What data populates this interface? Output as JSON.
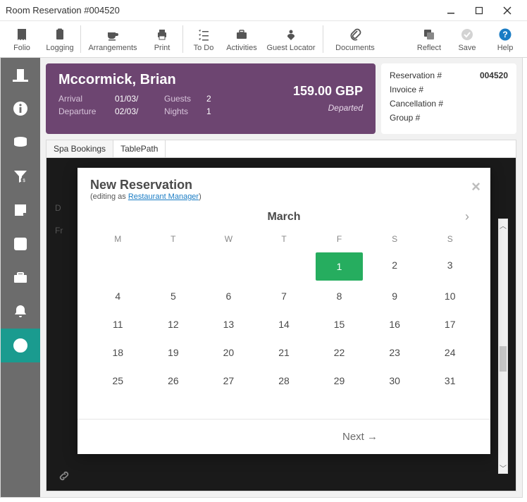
{
  "window": {
    "title": "Room Reservation #004520"
  },
  "toolbar": {
    "folio": "Folio",
    "logging": "Logging",
    "arrangements": "Arrangements",
    "print": "Print",
    "todo": "To Do",
    "activities": "Activities",
    "guest_locator": "Guest Locator",
    "documents": "Documents",
    "reflect": "Reflect",
    "save": "Save",
    "help": "Help"
  },
  "guest": {
    "name": "Mccormick, Brian",
    "arrival_label": "Arrival",
    "arrival": "01/03/",
    "departure_label": "Departure",
    "departure": "02/03/",
    "guests_label": "Guests",
    "guests": "2",
    "nights_label": "Nights",
    "nights": "1",
    "amount": "159.00 GBP",
    "status": "Departed"
  },
  "ref": {
    "reservation_label": "Reservation #",
    "reservation": "004520",
    "invoice_label": "Invoice #",
    "invoice": "",
    "cancellation_label": "Cancellation #",
    "cancellation": "",
    "group_label": "Group #",
    "group": ""
  },
  "tabs": {
    "spa": "Spa Bookings",
    "tablepath": "TablePath"
  },
  "bg": {
    "label1": "D",
    "label2": "Fr"
  },
  "modal": {
    "title": "New Reservation",
    "editing_prefix": "(editing as  ",
    "role": "Restaurant Manager",
    "editing_suffix": ")",
    "month": "March",
    "dows": [
      "M",
      "T",
      "W",
      "T",
      "F",
      "S",
      "S"
    ],
    "weeks": [
      [
        "",
        "",
        "",
        "",
        "1",
        "2",
        "3"
      ],
      [
        "4",
        "5",
        "6",
        "7",
        "8",
        "9",
        "10"
      ],
      [
        "11",
        "12",
        "13",
        "14",
        "15",
        "16",
        "17"
      ],
      [
        "18",
        "19",
        "20",
        "21",
        "22",
        "23",
        "24"
      ],
      [
        "25",
        "26",
        "27",
        "28",
        "29",
        "30",
        "31"
      ]
    ],
    "selected": "1",
    "next": "Next →"
  }
}
